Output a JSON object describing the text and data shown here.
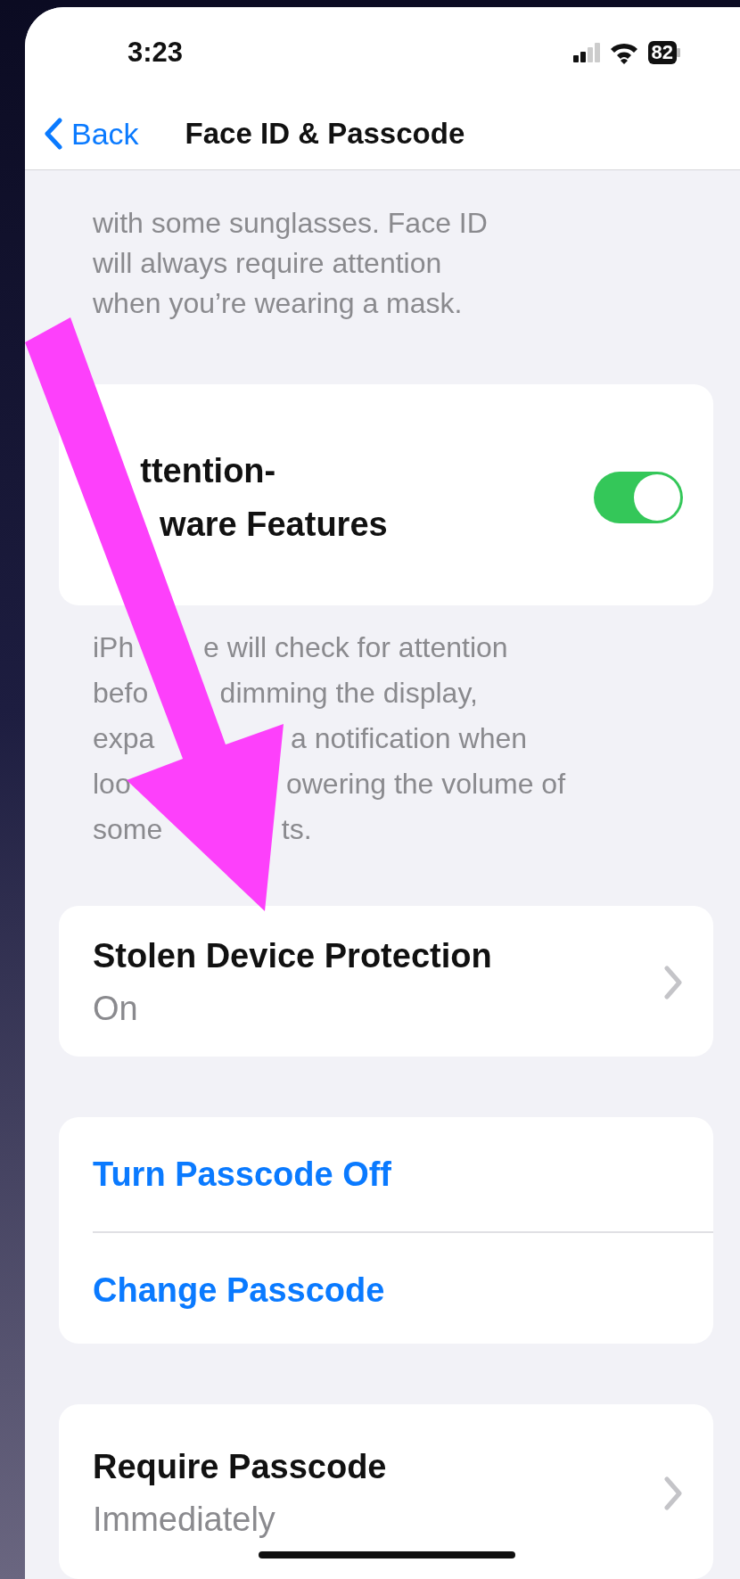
{
  "status_bar": {
    "time": "3:23",
    "battery": "82"
  },
  "nav": {
    "back": "Back",
    "title": "Face ID & Passcode"
  },
  "sections": [
    {
      "kind": "note",
      "lines": [
        {
          "text": "with some sunglasses. Face ID"
        },
        {
          "text": "will always require attention"
        },
        {
          "text": "when you’re wearing a mask."
        }
      ]
    },
    {
      "kind": "group",
      "rows": [
        {
          "kind": "toggle",
          "lines": [
            {
              "after": "ttention-"
            },
            {
              "after": "ware Features"
            }
          ],
          "on": true
        }
      ]
    },
    {
      "kind": "note",
      "lines": [
        {
          "before": "iPh",
          "after": "e will check for attention"
        },
        {
          "before": "befo",
          "after": "dimming the display,"
        },
        {
          "before": "expa",
          "after": "a notification when"
        },
        {
          "before": "loo",
          "after": "owering the volume of"
        },
        {
          "before": "some",
          "after": "ts."
        }
      ]
    },
    {
      "kind": "group",
      "rows": [
        {
          "kind": "detail",
          "label": "Stolen Device Protection",
          "value": "On"
        }
      ]
    },
    {
      "kind": "group",
      "rows": [
        {
          "kind": "action",
          "label": "Turn Passcode Off"
        },
        {
          "kind": "action",
          "label": "Change Passcode"
        }
      ]
    },
    {
      "kind": "group",
      "rows": [
        {
          "kind": "detail",
          "label": "Require Passcode",
          "value": "Immediately"
        }
      ]
    }
  ]
}
